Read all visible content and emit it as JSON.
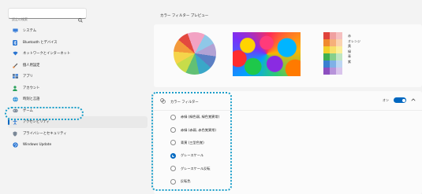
{
  "search": {
    "placeholder": "設定の検索"
  },
  "sidebar": {
    "items": [
      {
        "label": "システム",
        "icon": "monitor-icon"
      },
      {
        "label": "Bluetooth とデバイス",
        "icon": "bluetooth-icon"
      },
      {
        "label": "ネットワークとインターネット",
        "icon": "wifi-icon"
      },
      {
        "label": "個人用設定",
        "icon": "brush-icon"
      },
      {
        "label": "アプリ",
        "icon": "apps-icon"
      },
      {
        "label": "アカウント",
        "icon": "person-icon"
      },
      {
        "label": "時刻と言語",
        "icon": "globe-icon"
      },
      {
        "label": "ゲーム",
        "icon": "gamepad-icon"
      },
      {
        "label": "アクセシビリティ",
        "icon": "accessibility-icon"
      },
      {
        "label": "プライバシーとセキュリティ",
        "icon": "shield-icon"
      },
      {
        "label": "Windows Update",
        "icon": "update-icon"
      }
    ],
    "active_index": 8
  },
  "preview": {
    "title": "カラー フィルター プレビュー",
    "swatch_labels": [
      "赤",
      "オレンジ",
      "黄",
      "緑",
      "青",
      "紫"
    ]
  },
  "colors": {
    "accent": "#0067c0",
    "highlight": "#1a9ec9",
    "swatches": [
      [
        "#e0433b",
        "#f0a0a0",
        "#f5c0c0"
      ],
      [
        "#f08a30",
        "#f6b07a",
        "#fbd3b0"
      ],
      [
        "#f3d02a",
        "#f7e06a",
        "#fbef9a"
      ],
      [
        "#3fb050",
        "#86cf8c",
        "#bfe6c2"
      ],
      [
        "#3a7fd0",
        "#7fb0e6",
        "#bcd6f2"
      ],
      [
        "#8d4fc0",
        "#b793da",
        "#d9c4ec"
      ]
    ]
  },
  "filter": {
    "title": "カラー フィルター",
    "toggle_label": "オン",
    "toggle_on": true,
    "options": [
      "赤緑 (緑色弱, 緑色覚異常)",
      "赤緑 (赤弱, 赤色覚異常)",
      "青黄 (三型色覚)",
      "グレースケール",
      "グレースケール反転",
      "反転色"
    ],
    "selected_index": 3
  }
}
